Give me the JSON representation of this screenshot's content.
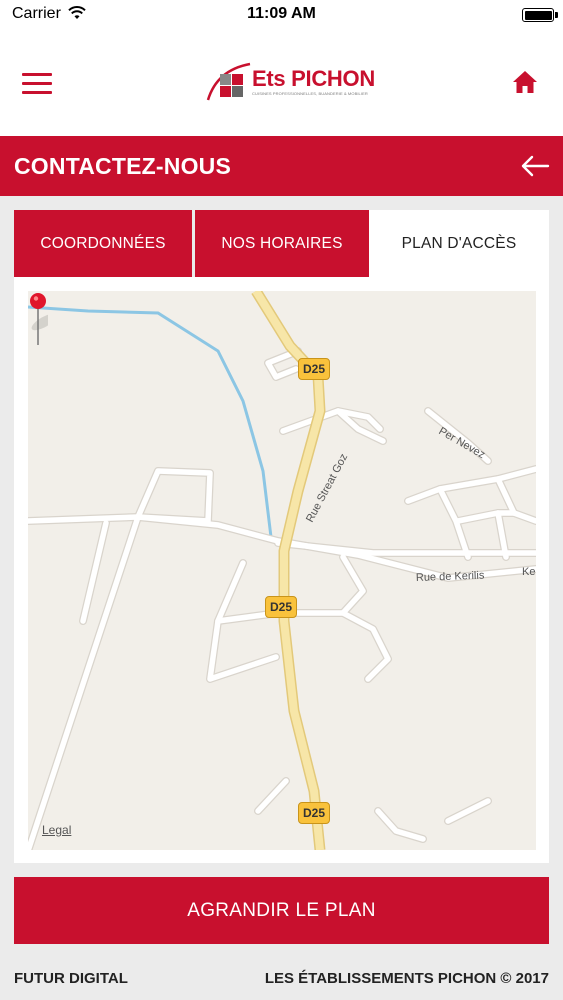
{
  "status_bar": {
    "carrier": "Carrier",
    "time": "11:09 AM"
  },
  "header": {
    "logo_name": "Ets PICHON",
    "logo_tagline": "CUISINES PROFESSIONNELLES, BUANDERIE & MOBILIER",
    "menu_icon": "hamburger-menu-icon",
    "home_icon": "home-icon"
  },
  "title_bar": {
    "title": "CONTACTEZ-NOUS",
    "back_icon": "arrow-left-icon"
  },
  "tabs": [
    {
      "label": "COORDONNÉES",
      "active": false
    },
    {
      "label": "NOS HORAIRES",
      "active": false
    },
    {
      "label": "PLAN D'ACCÈS",
      "active": true
    }
  ],
  "map": {
    "road_shields": [
      "D25",
      "D25",
      "D25"
    ],
    "street_labels": [
      "Rue Streat Goz",
      "Per Nevez",
      "Rue de Kerilis",
      "Ker"
    ],
    "legal": "Legal"
  },
  "button": {
    "label": "AGRANDIR LE PLAN"
  },
  "footer": {
    "left": "FUTUR DIGITAL",
    "right": "LES ÉTABLISSEMENTS PICHON © 2017"
  },
  "colors": {
    "brand_red": "#c8102e",
    "map_background": "#f2efe9",
    "main_road": "#f5e3a2",
    "water": "#8cc6e4"
  }
}
